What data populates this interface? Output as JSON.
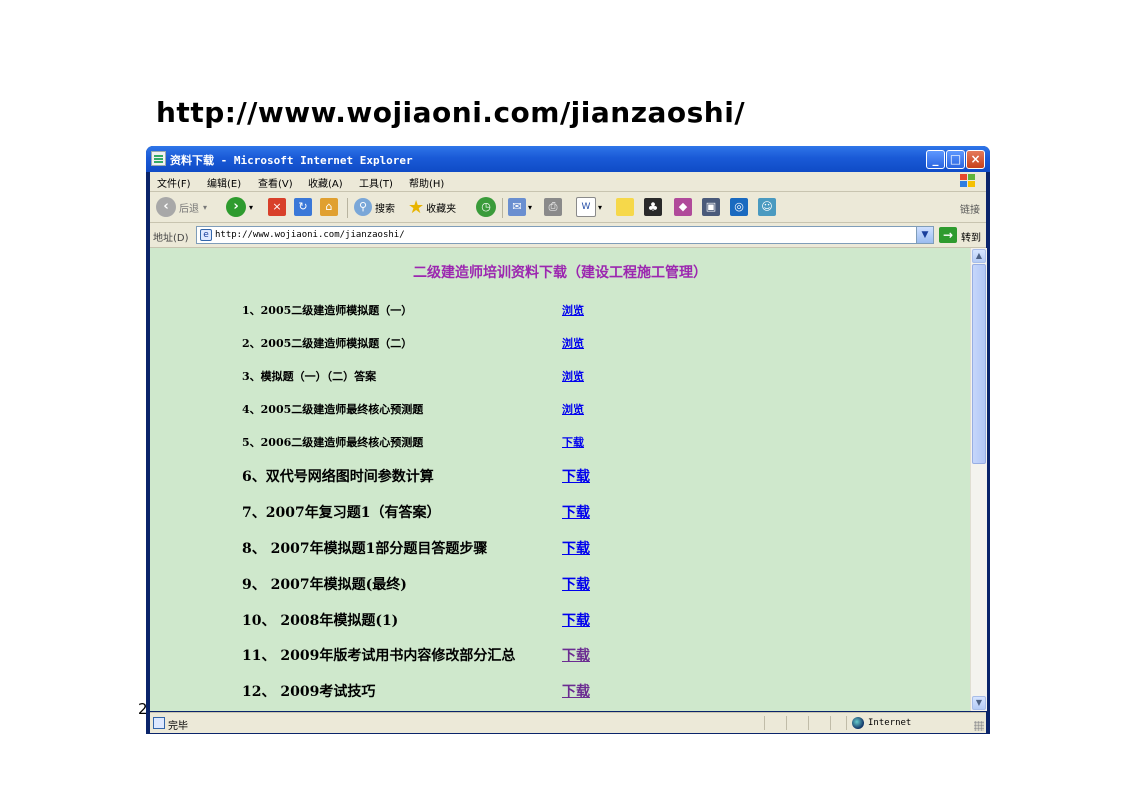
{
  "slide": {
    "url_heading": "http://www.wojiaoni.com/jianzaoshi/",
    "page_number": "2"
  },
  "window": {
    "title": "资料下载 - Microsoft Internet Explorer",
    "controls": {
      "minimize": "_",
      "maximize": "□",
      "close": "×"
    }
  },
  "menubar": {
    "items": [
      "文件(F)",
      "编辑(E)",
      "查看(V)",
      "收藏(A)",
      "工具(T)",
      "帮助(H)"
    ]
  },
  "toolbar": {
    "back_label": "后退",
    "search_label": "搜索",
    "favorites_label": "收藏夹",
    "links_label": "链接"
  },
  "addressbar": {
    "label": "地址(D)",
    "url": "http://www.wojiaoni.com/jianzaoshi/",
    "go_label": "转到"
  },
  "content": {
    "heading": "二级建造师培训资料下载（建设工程施工管理）",
    "rows": [
      {
        "label": "1、2005二级建造师模拟题（一）",
        "link": "浏览"
      },
      {
        "label": "2、2005二级建造师模拟题（二）",
        "link": "浏览"
      },
      {
        "label": "3、模拟题（一）（二）答案",
        "link": "浏览"
      },
      {
        "label": "4、2005二级建造师最终核心预测题",
        "link": "浏览"
      },
      {
        "label": "5、2006二级建造师最终核心预测题",
        "link": "下载"
      },
      {
        "label": "6、双代号网络图时间参数计算",
        "link": "下载"
      },
      {
        "label": "7、2007年复习题1（有答案）",
        "link": "下载"
      },
      {
        "label": "8、 2007年模拟题1部分题目答题步骤",
        "link": "下载"
      },
      {
        "label": "9、 2007年模拟题(最终)",
        "link": "下载"
      },
      {
        "label": "10、 2008年模拟题(1)",
        "link": "下载"
      },
      {
        "label": "11、 2009年版考试用书内容修改部分汇总",
        "link": "下载"
      },
      {
        "label": "12、 2009考试技巧",
        "link": "下载"
      }
    ]
  },
  "statusbar": {
    "text": "完毕",
    "zone": "Internet"
  },
  "colors": {
    "content_background": "#cfe8cc",
    "heading": "#9c27b0",
    "link": "#0000ee",
    "visited_link": "#6b2c91",
    "titlebar": "#1a5ad7"
  }
}
